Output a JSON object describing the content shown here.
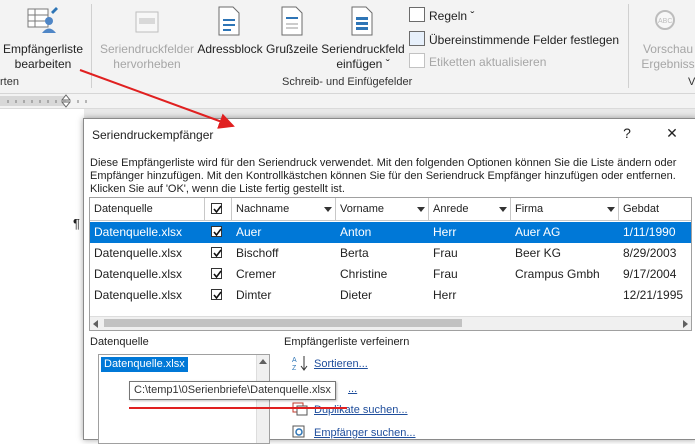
{
  "ribbon": {
    "start_merge": {
      "label_line1": "Empfängerliste",
      "label_line2": "bearbeiten"
    },
    "highlight_fields": {
      "label_line1": "Seriendruckfelder",
      "label_line2": "hervorheben"
    },
    "address_block": {
      "label": "Adressblock"
    },
    "greeting_line": {
      "label": "Grußzeile"
    },
    "insert_field": {
      "label_line1": "Seriendruckfeld",
      "label_line2": "einfügen ˇ"
    },
    "rules": {
      "label": "Regeln ˇ"
    },
    "match_fields": {
      "label": "Übereinstimmende Felder festlegen"
    },
    "update_labels": {
      "label": "Etiketten aktualisieren"
    },
    "preview": {
      "label_line1": "Vorschau",
      "label_line2": "Ergebniss"
    },
    "group_left": "rten",
    "group_write": "Schreib- und Einfügefelder",
    "group_right": "V"
  },
  "document": {
    "paragraph_mark": "¶"
  },
  "dialog": {
    "title": "Seriendruckempfänger",
    "help": "?",
    "close": "✕",
    "description": "Diese Empfängerliste wird für den Seriendruck verwendet. Mit den folgenden Optionen können Sie die Liste ändern oder Empfänger hinzufügen. Mit den Kontrollkästchen können Sie für den Seriendruck Empfänger hinzufügen oder entfernen. Klicken Sie auf 'OK', wenn die Liste fertig gestellt ist.",
    "table": {
      "columns": [
        "Datenquelle",
        "",
        "Nachname",
        "Vorname",
        "Anrede",
        "Firma",
        "Gebdat"
      ],
      "rows": [
        [
          "Datenquelle.xlsx",
          true,
          "Auer",
          "Anton",
          "Herr",
          "Auer AG",
          "1/11/1990"
        ],
        [
          "Datenquelle.xlsx",
          true,
          "Bischoff",
          "Berta",
          "Frau",
          "Beer KG",
          "8/29/2003"
        ],
        [
          "Datenquelle.xlsx",
          true,
          "Cremer",
          "Christine",
          "Frau",
          "Crampus Gmbh",
          "9/17/2004"
        ],
        [
          "Datenquelle.xlsx",
          true,
          "Dimter",
          "Dieter",
          "Herr",
          "",
          "12/21/1995"
        ]
      ],
      "selected_row": 0
    },
    "datasource": {
      "label": "Datenquelle",
      "items": [
        "Datenquelle.xlsx"
      ]
    },
    "refine": {
      "label": "Empfängerliste verfeinern",
      "sort": "Sortieren...",
      "filter": "...",
      "duplicates": "Duplikate suchen...",
      "find": "Empfänger suchen..."
    },
    "tooltip": "C:\\temp1\\0Serienbriefe\\Datenquelle.xlsx"
  },
  "colors": {
    "selection": "#0078d7",
    "annotation": "#e02020",
    "link": "#1f4e9c"
  }
}
